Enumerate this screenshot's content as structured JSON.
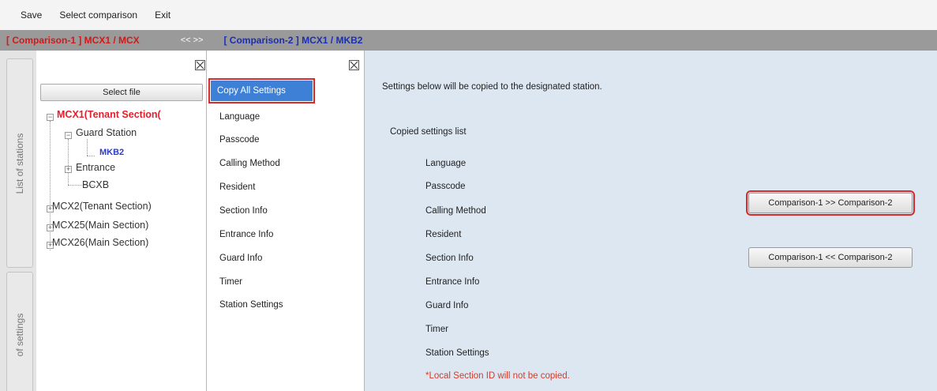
{
  "menu": {
    "save": "Save",
    "select_comparison": "Select comparison",
    "exit": "Exit"
  },
  "comparison_bar": {
    "comparison1": "[ Comparison-1 ] MCX1 / MCX",
    "swap": "<< >>",
    "comparison2": "[ Comparison-2 ] MCX1 / MKB2"
  },
  "side_tabs": {
    "stations": "List of stations",
    "settings": "of settings"
  },
  "stations": {
    "select_file": "Select file",
    "tree": [
      {
        "label": "MCX1(Tenant Section(",
        "style": "red",
        "expander": "−"
      },
      {
        "label": "Guard Station",
        "style": "normal",
        "expander": "−"
      },
      {
        "label": "MKB2",
        "style": "blue",
        "expander": ""
      },
      {
        "label": "Entrance",
        "style": "normal",
        "expander": "+"
      },
      {
        "label": "BCXB",
        "style": "normal",
        "expander": ""
      },
      {
        "label": "MCX2(Tenant Section)",
        "style": "normal",
        "expander": "+"
      },
      {
        "label": "MCX25(Main Section)",
        "style": "normal",
        "expander": "+"
      },
      {
        "label": "MCX26(Main Section)",
        "style": "normal",
        "expander": "+"
      }
    ]
  },
  "settings_list": {
    "items": [
      "Copy All Settings",
      "Language",
      "Passcode",
      "Calling Method",
      "Resident",
      "Section Info",
      "Entrance Info",
      "Guard Info",
      "Timer",
      "Station Settings"
    ]
  },
  "copy_panel": {
    "header": "Settings below will be copied to the designated station.",
    "list_title": "Copied settings list",
    "items": [
      "Language",
      "Passcode",
      "Calling Method",
      "Resident",
      "Section Info",
      "Entrance Info",
      "Guard Info",
      "Timer",
      "Station Settings"
    ],
    "note": "*Local Section ID will not be copied.",
    "btn_forward": "Comparison-1 >> Comparison-2",
    "btn_backward": "Comparison-1 << Comparison-2"
  },
  "colors": {
    "accent_red": "#d82a2a",
    "selected_blue": "#3e80d6",
    "panel_bg": "#dce7f2"
  }
}
